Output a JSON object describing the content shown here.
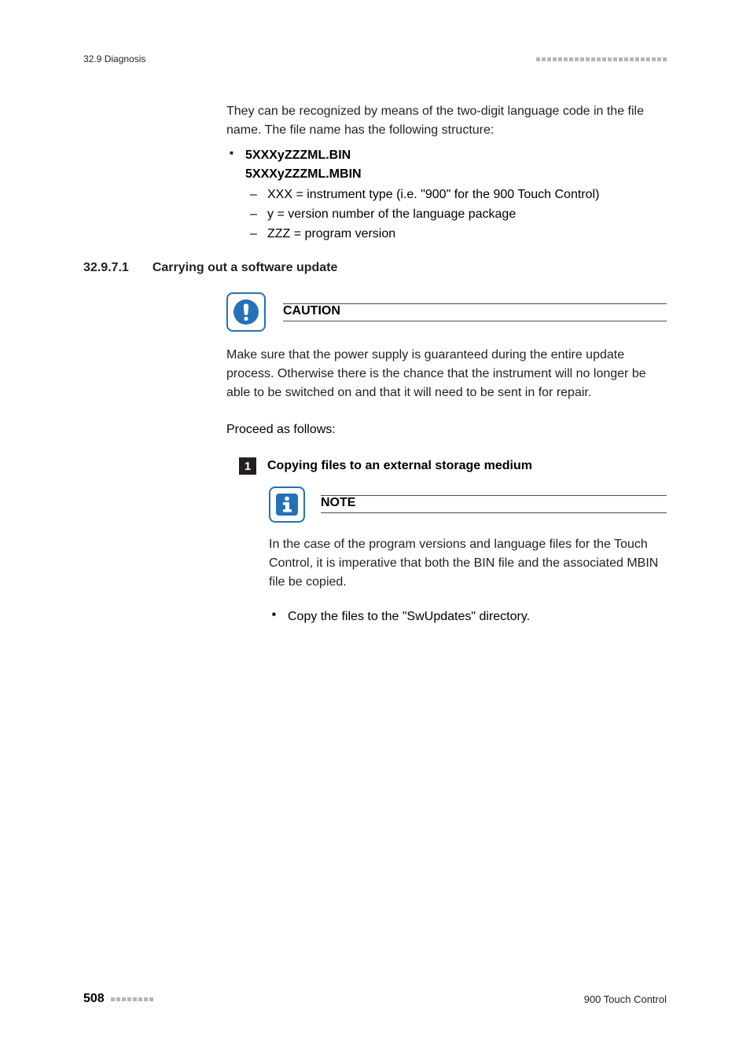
{
  "header": {
    "section_label": "32.9 Diagnosis"
  },
  "intro_para": "They can be recognized by means of the two-digit language code in the file name. The file name has the following structure:",
  "file_pattern": {
    "line1": "5XXXyZZZML.BIN",
    "line2": "5XXXyZZZML.MBIN",
    "sub1": "XXX = instrument type (i.e. \"900\" for the 900 Touch Control)",
    "sub2": "y = version number of the language package",
    "sub3": "ZZZ = program version"
  },
  "section": {
    "number": "32.9.7.1",
    "title": "Carrying out a software update"
  },
  "caution": {
    "label": "CAUTION",
    "body": "Make sure that the power supply is guaranteed during the entire update process. Otherwise there is the chance that the instrument will no longer be able to be switched on and that it will need to be sent in for repair."
  },
  "proceed_text": "Proceed as follows:",
  "step1": {
    "num": "1",
    "title": "Copying files to an external storage medium"
  },
  "note": {
    "label": "NOTE",
    "body": "In the case of the program versions and language files for the Touch Control, it is imperative that both the BIN file and the associated MBIN file be copied."
  },
  "copy_bullet": "Copy the files to the \"SwUpdates\" directory.",
  "footer": {
    "page": "508",
    "doc": "900 Touch Control"
  }
}
